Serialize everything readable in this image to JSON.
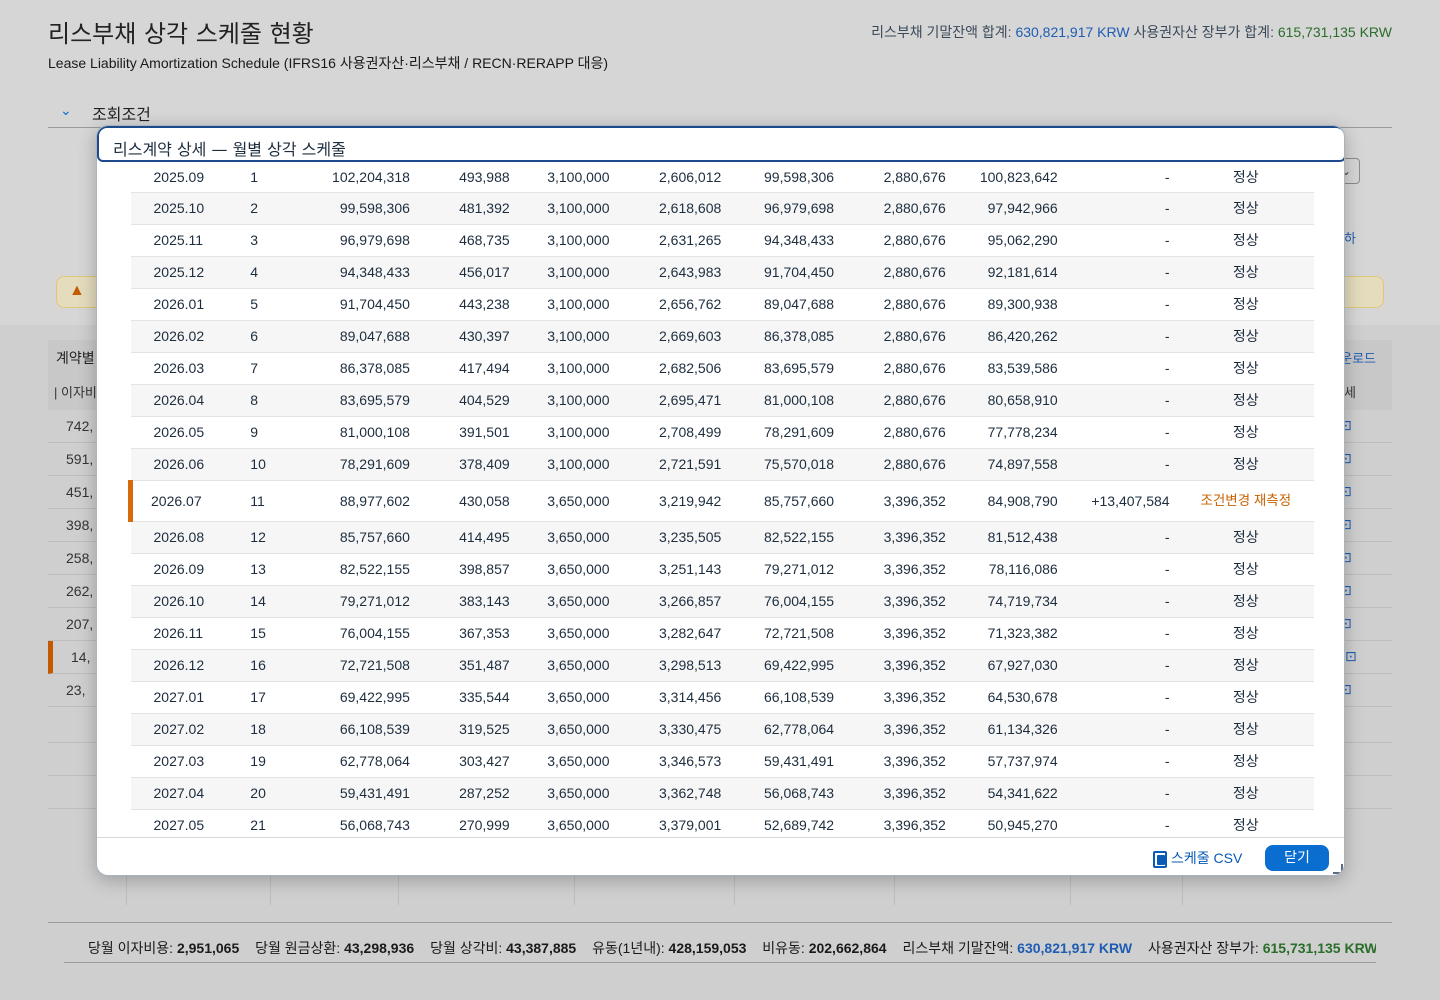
{
  "page": {
    "title": "리스부채 상각 스케줄 현황",
    "subtitle": "Lease Liability Amortization Schedule (IFRS16 사용권자산·리스부채 / RECN·RERAPP 대응)",
    "header_liability_label": "리스부채 기말잔액 합계:",
    "header_liability_value": "630,821,917 KRW",
    "header_asset_label": "사용권자산 장부가 합계:",
    "header_asset_value": "615,731,135 KRW"
  },
  "filter": {
    "chevron": "⌄",
    "label": "조회조건"
  },
  "background_table": {
    "title_frag": "계약별",
    "col_frag": "| 이자비",
    "download_frag": "운로드",
    "detail_frag": "세",
    "link_frag": "하",
    "rows": [
      "742,",
      "591,",
      "451,",
      "398,",
      "258,",
      "262,",
      "207,",
      "14,",
      "23,"
    ],
    "row_link": "⊡"
  },
  "footer": {
    "interest_label": "당월 이자비용:",
    "interest_value": "2,951,065",
    "principal_label": "당월 원금상환:",
    "principal_value": "43,298,936",
    "depr_label": "당월 상각비:",
    "depr_value": "43,387,885",
    "current_label": "유동(1년내):",
    "current_value": "428,159,053",
    "noncurrent_label": "비유동:",
    "noncurrent_value": "202,662,864",
    "liability_label": "리스부채 기말잔액:",
    "liability_value": "630,821,917 KRW",
    "asset_label": "사용권자산 장부가:",
    "asset_value": "615,731,135 KRW"
  },
  "dialog": {
    "title": "리스계약 상세 — 월별 상각 스케줄",
    "csv_label": "스케줄 CSV",
    "close_label": "닫기",
    "rows": [
      {
        "month": "2025.09",
        "no": "1",
        "a": "102,204,318",
        "b": "493,988",
        "c": "3,100,000",
        "d": "2,606,012",
        "e": "99,598,306",
        "f": "2,880,676",
        "g": "100,823,642",
        "h": "-",
        "status": "정상"
      },
      {
        "month": "2025.10",
        "no": "2",
        "a": "99,598,306",
        "b": "481,392",
        "c": "3,100,000",
        "d": "2,618,608",
        "e": "96,979,698",
        "f": "2,880,676",
        "g": "97,942,966",
        "h": "-",
        "status": "정상"
      },
      {
        "month": "2025.11",
        "no": "3",
        "a": "96,979,698",
        "b": "468,735",
        "c": "3,100,000",
        "d": "2,631,265",
        "e": "94,348,433",
        "f": "2,880,676",
        "g": "95,062,290",
        "h": "-",
        "status": "정상"
      },
      {
        "month": "2025.12",
        "no": "4",
        "a": "94,348,433",
        "b": "456,017",
        "c": "3,100,000",
        "d": "2,643,983",
        "e": "91,704,450",
        "f": "2,880,676",
        "g": "92,181,614",
        "h": "-",
        "status": "정상"
      },
      {
        "month": "2026.01",
        "no": "5",
        "a": "91,704,450",
        "b": "443,238",
        "c": "3,100,000",
        "d": "2,656,762",
        "e": "89,047,688",
        "f": "2,880,676",
        "g": "89,300,938",
        "h": "-",
        "status": "정상"
      },
      {
        "month": "2026.02",
        "no": "6",
        "a": "89,047,688",
        "b": "430,397",
        "c": "3,100,000",
        "d": "2,669,603",
        "e": "86,378,085",
        "f": "2,880,676",
        "g": "86,420,262",
        "h": "-",
        "status": "정상"
      },
      {
        "month": "2026.03",
        "no": "7",
        "a": "86,378,085",
        "b": "417,494",
        "c": "3,100,000",
        "d": "2,682,506",
        "e": "83,695,579",
        "f": "2,880,676",
        "g": "83,539,586",
        "h": "-",
        "status": "정상"
      },
      {
        "month": "2026.04",
        "no": "8",
        "a": "83,695,579",
        "b": "404,529",
        "c": "3,100,000",
        "d": "2,695,471",
        "e": "81,000,108",
        "f": "2,880,676",
        "g": "80,658,910",
        "h": "-",
        "status": "정상"
      },
      {
        "month": "2026.05",
        "no": "9",
        "a": "81,000,108",
        "b": "391,501",
        "c": "3,100,000",
        "d": "2,708,499",
        "e": "78,291,609",
        "f": "2,880,676",
        "g": "77,778,234",
        "h": "-",
        "status": "정상"
      },
      {
        "month": "2026.06",
        "no": "10",
        "a": "78,291,609",
        "b": "378,409",
        "c": "3,100,000",
        "d": "2,721,591",
        "e": "75,570,018",
        "f": "2,880,676",
        "g": "74,897,558",
        "h": "-",
        "status": "정상"
      },
      {
        "month": "2026.07",
        "no": "11",
        "a": "88,977,602",
        "b": "430,058",
        "c": "3,650,000",
        "d": "3,219,942",
        "e": "85,757,660",
        "f": "3,396,352",
        "g": "84,908,790",
        "h": "+13,407,584",
        "status": "조건변경 재측정",
        "remeasure": true
      },
      {
        "month": "2026.08",
        "no": "12",
        "a": "85,757,660",
        "b": "414,495",
        "c": "3,650,000",
        "d": "3,235,505",
        "e": "82,522,155",
        "f": "3,396,352",
        "g": "81,512,438",
        "h": "-",
        "status": "정상"
      },
      {
        "month": "2026.09",
        "no": "13",
        "a": "82,522,155",
        "b": "398,857",
        "c": "3,650,000",
        "d": "3,251,143",
        "e": "79,271,012",
        "f": "3,396,352",
        "g": "78,116,086",
        "h": "-",
        "status": "정상"
      },
      {
        "month": "2026.10",
        "no": "14",
        "a": "79,271,012",
        "b": "383,143",
        "c": "3,650,000",
        "d": "3,266,857",
        "e": "76,004,155",
        "f": "3,396,352",
        "g": "74,719,734",
        "h": "-",
        "status": "정상"
      },
      {
        "month": "2026.11",
        "no": "15",
        "a": "76,004,155",
        "b": "367,353",
        "c": "3,650,000",
        "d": "3,282,647",
        "e": "72,721,508",
        "f": "3,396,352",
        "g": "71,323,382",
        "h": "-",
        "status": "정상"
      },
      {
        "month": "2026.12",
        "no": "16",
        "a": "72,721,508",
        "b": "351,487",
        "c": "3,650,000",
        "d": "3,298,513",
        "e": "69,422,995",
        "f": "3,396,352",
        "g": "67,927,030",
        "h": "-",
        "status": "정상"
      },
      {
        "month": "2027.01",
        "no": "17",
        "a": "69,422,995",
        "b": "335,544",
        "c": "3,650,000",
        "d": "3,314,456",
        "e": "66,108,539",
        "f": "3,396,352",
        "g": "64,530,678",
        "h": "-",
        "status": "정상"
      },
      {
        "month": "2027.02",
        "no": "18",
        "a": "66,108,539",
        "b": "319,525",
        "c": "3,650,000",
        "d": "3,330,475",
        "e": "62,778,064",
        "f": "3,396,352",
        "g": "61,134,326",
        "h": "-",
        "status": "정상"
      },
      {
        "month": "2027.03",
        "no": "19",
        "a": "62,778,064",
        "b": "303,427",
        "c": "3,650,000",
        "d": "3,346,573",
        "e": "59,431,491",
        "f": "3,396,352",
        "g": "57,737,974",
        "h": "-",
        "status": "정상"
      },
      {
        "month": "2027.04",
        "no": "20",
        "a": "59,431,491",
        "b": "287,252",
        "c": "3,650,000",
        "d": "3,362,748",
        "e": "56,068,743",
        "f": "3,396,352",
        "g": "54,341,622",
        "h": "-",
        "status": "정상"
      },
      {
        "month": "2027.05",
        "no": "21",
        "a": "56,068,743",
        "b": "270,999",
        "c": "3,650,000",
        "d": "3,379,001",
        "e": "52,689,742",
        "f": "3,396,352",
        "g": "50,945,270",
        "h": "-",
        "status": "정상"
      }
    ]
  }
}
